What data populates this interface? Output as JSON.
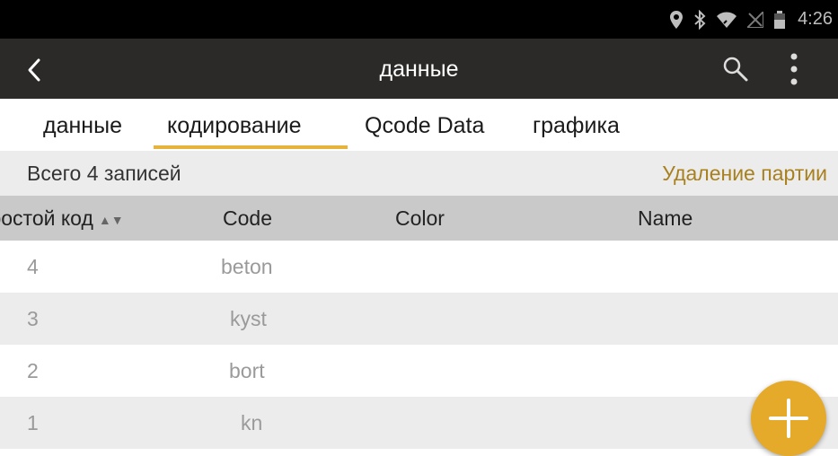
{
  "status_bar": {
    "time": "4:26",
    "icons": [
      "location-icon",
      "bluetooth-icon",
      "wifi-icon",
      "signal-icon",
      "battery-icon"
    ]
  },
  "app_bar": {
    "title": "данные",
    "back_icon": "back-arrow-icon",
    "search_icon": "search-icon",
    "more_icon": "more-vert-icon"
  },
  "tabs": [
    {
      "label": "данные",
      "selected": false
    },
    {
      "label": "кодирование",
      "selected": true
    },
    {
      "label": "Qcode Data",
      "selected": false
    },
    {
      "label": "графика",
      "selected": false
    }
  ],
  "summary": {
    "count_text": "Всего 4 записей",
    "action_label": "Удаление партии"
  },
  "table": {
    "columns": [
      "простой код",
      "Code",
      "Color",
      "Name"
    ],
    "rows": [
      {
        "id": "4",
        "code": "beton",
        "color": "",
        "name": ""
      },
      {
        "id": "3",
        "code": "kyst",
        "color": "",
        "name": ""
      },
      {
        "id": "2",
        "code": "bort",
        "color": "",
        "name": ""
      },
      {
        "id": "1",
        "code": "kn",
        "color": "",
        "name": ""
      }
    ]
  },
  "fab": {
    "icon": "plus-icon"
  },
  "colors": {
    "accent": "#e6aa2a",
    "action_text": "#a8801e",
    "app_bar": "#2b2a28"
  }
}
